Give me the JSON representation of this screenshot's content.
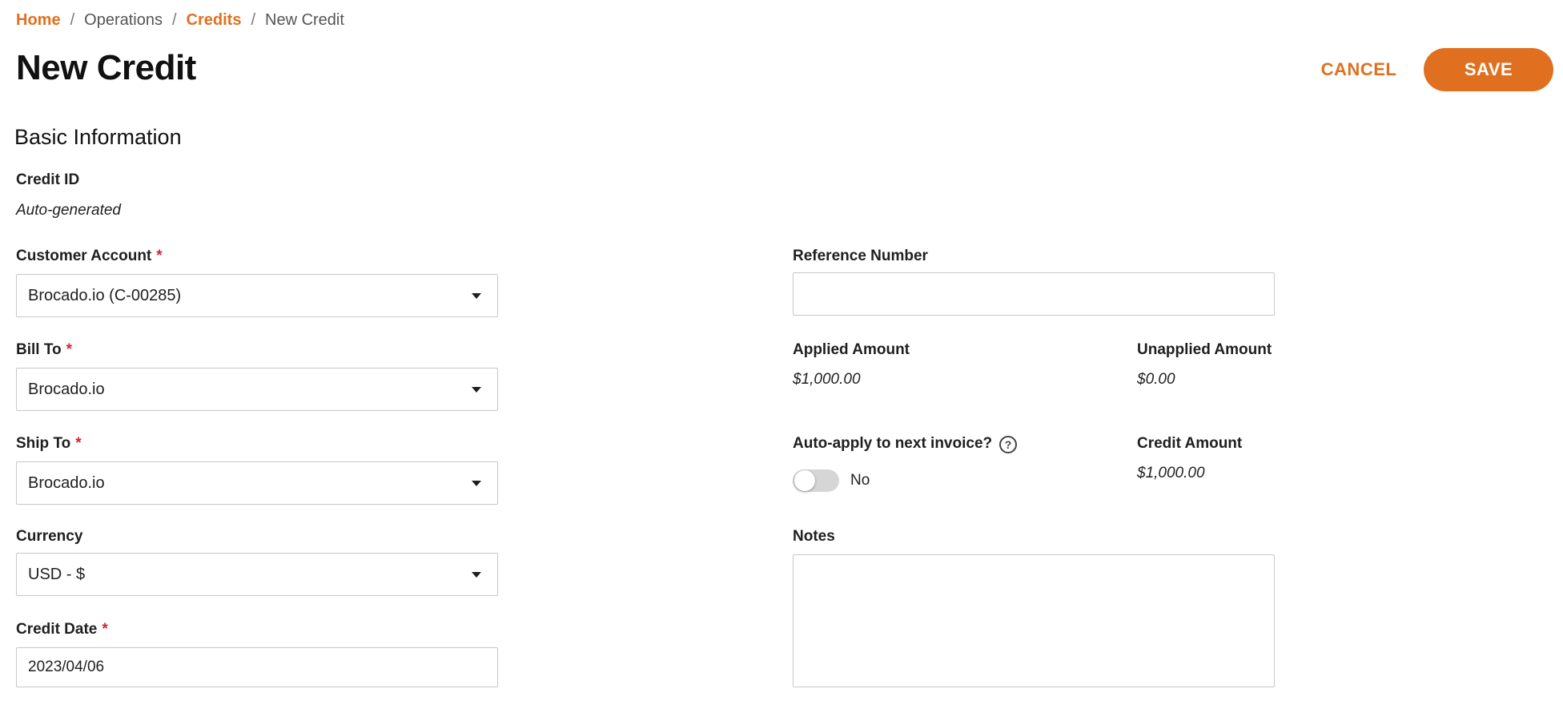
{
  "breadcrumb": {
    "home": "Home",
    "operations": "Operations",
    "credits": "Credits",
    "current": "New Credit",
    "separator": "/"
  },
  "header": {
    "title": "New Credit",
    "cancel_label": "CANCEL",
    "save_label": "SAVE"
  },
  "section": {
    "title": "Basic Information"
  },
  "form": {
    "credit_id": {
      "label": "Credit ID",
      "value": "Auto-generated"
    },
    "customer_account": {
      "label": "Customer Account",
      "required": "*",
      "value": "Brocado.io (C-00285)"
    },
    "bill_to": {
      "label": "Bill To",
      "required": "*",
      "value": "Brocado.io"
    },
    "ship_to": {
      "label": "Ship To",
      "required": "*",
      "value": "Brocado.io"
    },
    "currency": {
      "label": "Currency",
      "value": "USD - $"
    },
    "credit_date": {
      "label": "Credit Date",
      "required": "*",
      "value": "2023/04/06"
    },
    "reference_number": {
      "label": "Reference Number",
      "value": ""
    },
    "applied_amount": {
      "label": "Applied Amount",
      "value": "$1,000.00"
    },
    "unapplied_amount": {
      "label": "Unapplied Amount",
      "value": "$0.00"
    },
    "auto_apply": {
      "label": "Auto-apply to next invoice?",
      "help": "?",
      "toggle_label": "No",
      "enabled": false
    },
    "credit_amount": {
      "label": "Credit Amount",
      "value": "$1,000.00"
    },
    "notes": {
      "label": "Notes",
      "value": ""
    }
  },
  "colors": {
    "accent": "#e07020",
    "required": "#d0262d"
  },
  "icons": {
    "dropdown": "chevron-down-icon",
    "help": "question-circle-icon"
  }
}
